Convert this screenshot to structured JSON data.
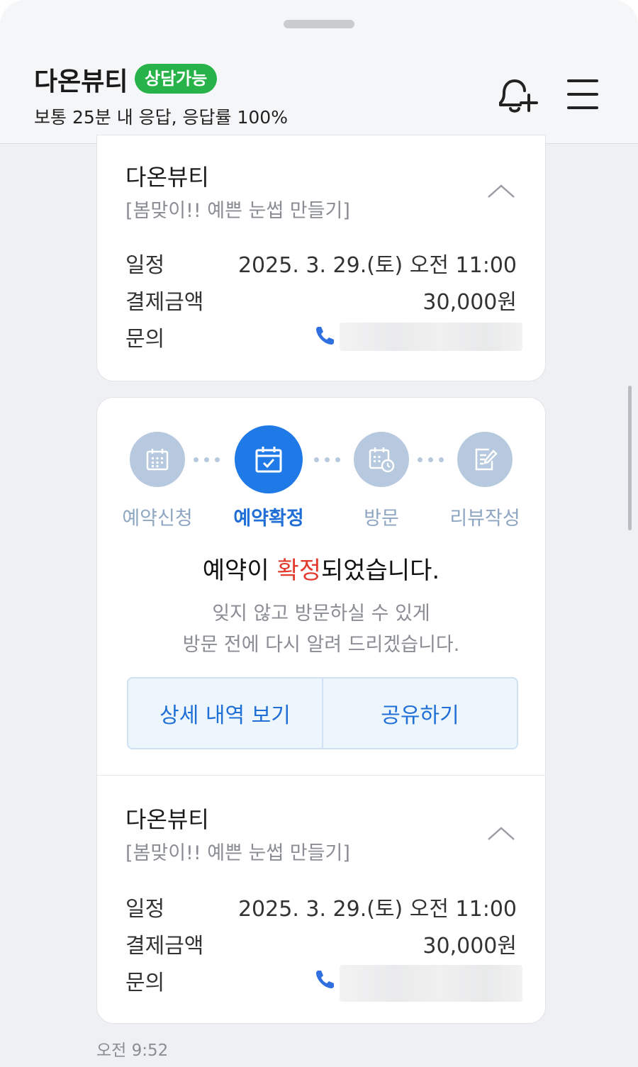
{
  "header": {
    "shop_name": "다온뷰티",
    "status_badge": "상담가능",
    "response_info": "보통 25분 내 응답, 응답률 100%"
  },
  "booking_cards": [
    {
      "title": "다온뷰티",
      "subtitle": "[봄맞이!! 예쁜 눈썹 만들기]",
      "schedule_label": "일정",
      "schedule_value": "2025. 3. 29.(토) 오전 11:00",
      "payment_label": "결제금액",
      "payment_value": "30,000원",
      "contact_label": "문의"
    },
    {
      "title": "다온뷰티",
      "subtitle": "[봄맞이!! 예쁜 눈썹 만들기]",
      "schedule_label": "일정",
      "schedule_value": "2025. 3. 29.(토) 오전 11:00",
      "payment_label": "결제금액",
      "payment_value": "30,000원",
      "contact_label": "문의"
    }
  ],
  "steps": [
    {
      "label": "예약신청",
      "icon": "calendar-icon",
      "active": false
    },
    {
      "label": "예약확정",
      "icon": "calendar-check-icon",
      "active": true
    },
    {
      "label": "방문",
      "icon": "calendar-clock-icon",
      "active": false
    },
    {
      "label": "리뷰작성",
      "icon": "edit-note-icon",
      "active": false
    }
  ],
  "confirmation": {
    "title_prefix": "예약이 ",
    "title_highlight": "확정",
    "title_suffix": "되었습니다.",
    "message_line1": "잊지 않고 방문하실 수 있게",
    "message_line2": "방문 전에 다시 알려 드리겠습니다.",
    "detail_button": "상세 내역 보기",
    "share_button": "공유하기"
  },
  "timestamp": "오전 9:52",
  "colors": {
    "accent": "#1f79e6",
    "badge_green": "#27b34a",
    "highlight_red": "#e23b2e",
    "step_inactive": "#b7c9df"
  }
}
